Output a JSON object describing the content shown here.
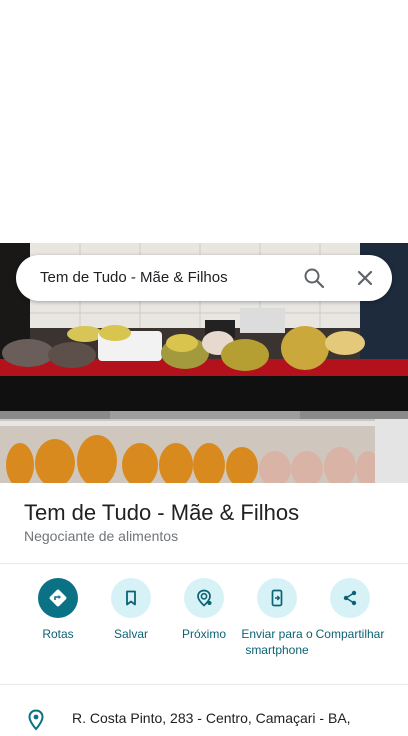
{
  "search": {
    "query": "Tem de Tudo - Mãe & Filhos"
  },
  "place": {
    "name": "Tem de Tudo - Mãe & Filhos",
    "category": "Negociante de alimentos",
    "address": "R. Costa Pinto, 283 - Centro, Camaçari - BA,"
  },
  "actions": [
    {
      "label": "Rotas",
      "icon": "directions-icon"
    },
    {
      "label": "Salvar",
      "icon": "bookmark-icon"
    },
    {
      "label": "Próximo",
      "icon": "nearby-icon"
    },
    {
      "label": "Enviar para o smartphone",
      "icon": "send-to-phone-icon"
    },
    {
      "label": "Compartilhar",
      "icon": "share-icon"
    }
  ],
  "colors": {
    "accent": "#0b7285",
    "accent_light": "#d7f2f7",
    "accent_text": "#0b6375"
  }
}
